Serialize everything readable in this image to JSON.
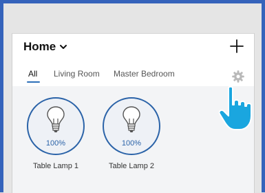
{
  "header": {
    "title": "Home",
    "dropdown_icon": "chevron-down-icon",
    "add_icon": "plus-icon"
  },
  "tabs": [
    {
      "label": "All",
      "active": true
    },
    {
      "label": "Living Room",
      "active": false
    },
    {
      "label": "Master Bedroom",
      "active": false
    }
  ],
  "settings_icon": "gear-icon",
  "devices": [
    {
      "name": "Table Lamp 1",
      "level": "100%",
      "icon": "lightbulb-icon"
    },
    {
      "name": "Table Lamp 2",
      "level": "100%",
      "icon": "lightbulb-icon"
    }
  ],
  "overlay": {
    "icon": "pointing-hand-icon"
  },
  "colors": {
    "frame": "#3563bb",
    "accent": "#2b63a8",
    "hand": "#1aa6df",
    "card_background": "#fafafa",
    "device_area": "#f3f4f6"
  }
}
